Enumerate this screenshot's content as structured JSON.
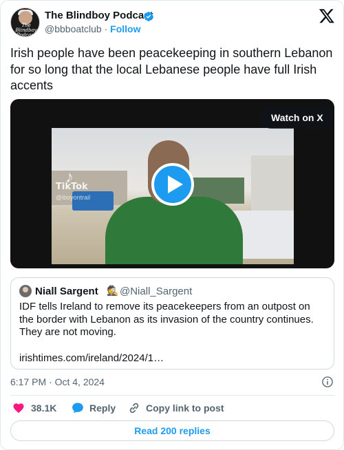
{
  "author": {
    "name": "The Blindboy Podcast",
    "handle": "@bbboatclub",
    "separator": "·",
    "follow_label": "Follow",
    "avatar_text": "The Blindboy Podcast"
  },
  "tweet": {
    "text": "Irish people have been peacekeeping in southern Lebanon for so long that the local Lebanese people have full Irish accents"
  },
  "media": {
    "watch_label": "Watch on X",
    "watermark": "TikTok",
    "watermark_user": "@iboyontrail"
  },
  "quote": {
    "name": "Niall Sargent",
    "emoji": "🕵",
    "handle": "@Niall_Sargent",
    "text": "IDF tells Ireland to remove its peacekeepers from an outpost on the border with Lebanon as its invasion of the country continues. They are not moving.",
    "link": "irishtimes.com/ireland/2024/1…"
  },
  "timestamp": "6:17 PM · Oct 4, 2024",
  "actions": {
    "likes": "38.1K",
    "reply_label": "Reply",
    "copy_label": "Copy link to post"
  },
  "read_replies_label": "Read 200 replies",
  "colors": {
    "accent": "#1d9bf0",
    "heart": "#f91880",
    "text": "#0f1419",
    "secondary": "#536471"
  }
}
